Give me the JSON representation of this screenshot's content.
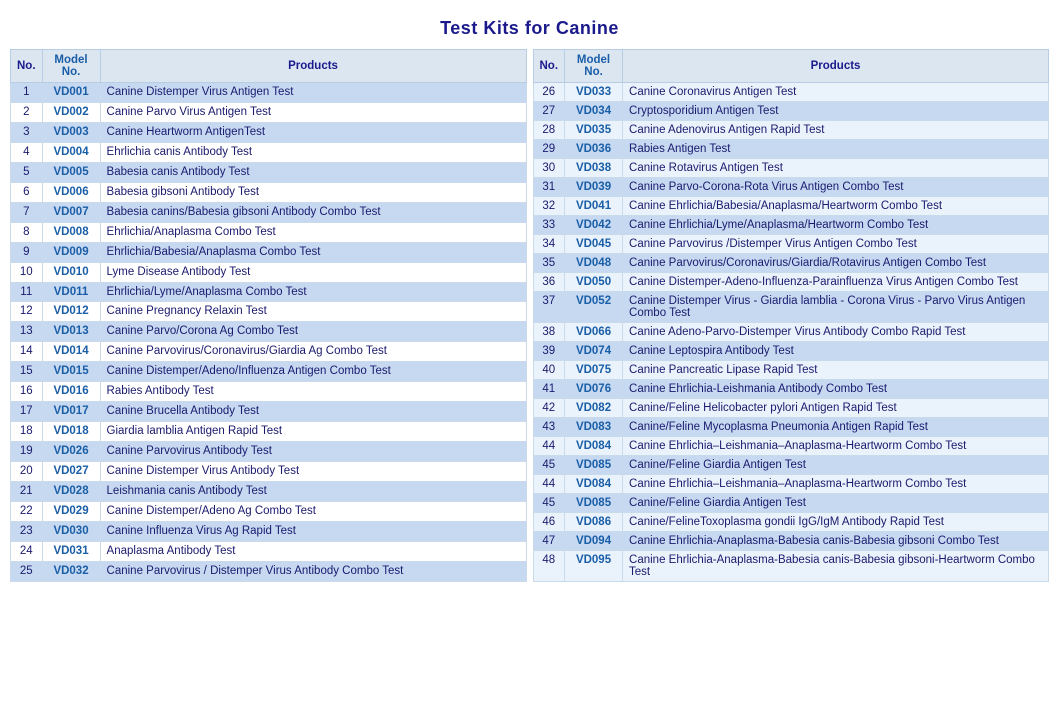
{
  "title": "Test Kits for Canine",
  "left_columns": [
    "No.",
    "Model No.",
    "Products"
  ],
  "right_columns": [
    "No.",
    "Model No.",
    "Products"
  ],
  "left_rows": [
    {
      "no": 1,
      "model": "VD001",
      "product": "Canine Distemper Virus Antigen Test",
      "highlight": true
    },
    {
      "no": 2,
      "model": "VD002",
      "product": "Canine Parvo Virus Antigen Test",
      "highlight": false
    },
    {
      "no": 3,
      "model": "VD003",
      "product": "Canine Heartworm AntigenTest",
      "highlight": true
    },
    {
      "no": 4,
      "model": "VD004",
      "product": "Ehrlichia canis Antibody Test",
      "highlight": false
    },
    {
      "no": 5,
      "model": "VD005",
      "product": "Babesia canis Antibody Test",
      "highlight": true
    },
    {
      "no": 6,
      "model": "VD006",
      "product": "Babesia gibsoni Antibody Test",
      "highlight": false
    },
    {
      "no": 7,
      "model": "VD007",
      "product": "Babesia canins/Babesia gibsoni Antibody Combo Test",
      "highlight": true
    },
    {
      "no": 8,
      "model": "VD008",
      "product": "Ehrlichia/Anaplasma Combo Test",
      "highlight": false
    },
    {
      "no": 9,
      "model": "VD009",
      "product": "Ehrlichia/Babesia/Anaplasma Combo Test",
      "highlight": true
    },
    {
      "no": 10,
      "model": "VD010",
      "product": "Lyme Disease Antibody Test",
      "highlight": false
    },
    {
      "no": 11,
      "model": "VD011",
      "product": "Ehrlichia/Lyme/Anaplasma Combo Test",
      "highlight": true
    },
    {
      "no": 12,
      "model": "VD012",
      "product": "Canine Pregnancy Relaxin Test",
      "highlight": false
    },
    {
      "no": 13,
      "model": "VD013",
      "product": "Canine Parvo/Corona Ag Combo Test",
      "highlight": true
    },
    {
      "no": 14,
      "model": "VD014",
      "product": "Canine Parvovirus/Coronavirus/Giardia Ag Combo Test",
      "highlight": false
    },
    {
      "no": 15,
      "model": "VD015",
      "product": "Canine Distemper/Adeno/Influenza Antigen Combo Test",
      "highlight": true
    },
    {
      "no": 16,
      "model": "VD016",
      "product": "Rabies Antibody Test",
      "highlight": false
    },
    {
      "no": 17,
      "model": "VD017",
      "product": "Canine Brucella Antibody Test",
      "highlight": true
    },
    {
      "no": 18,
      "model": "VD018",
      "product": "Giardia lamblia Antigen Rapid Test",
      "highlight": false
    },
    {
      "no": 19,
      "model": "VD026",
      "product": "Canine Parvovirus Antibody Test",
      "highlight": true
    },
    {
      "no": 20,
      "model": "VD027",
      "product": "Canine Distemper Virus Antibody Test",
      "highlight": false
    },
    {
      "no": 21,
      "model": "VD028",
      "product": "Leishmania canis Antibody Test",
      "highlight": true
    },
    {
      "no": 22,
      "model": "VD029",
      "product": "Canine Distemper/Adeno Ag Combo Test",
      "highlight": false
    },
    {
      "no": 23,
      "model": "VD030",
      "product": "Canine Influenza Virus Ag Rapid Test",
      "highlight": true
    },
    {
      "no": 24,
      "model": "VD031",
      "product": "Anaplasma Antibody Test",
      "highlight": false
    },
    {
      "no": 25,
      "model": "VD032",
      "product": "Canine Parvovirus / Distemper Virus Antibody Combo Test",
      "highlight": true
    }
  ],
  "right_rows": [
    {
      "no": 26,
      "model": "VD033",
      "product": "Canine Coronavirus Antigen Test",
      "highlight": false
    },
    {
      "no": 27,
      "model": "VD034",
      "product": "Cryptosporidium Antigen Test",
      "highlight": true
    },
    {
      "no": 28,
      "model": "VD035",
      "product": "Canine Adenovirus Antigen Rapid Test",
      "highlight": false
    },
    {
      "no": 29,
      "model": "VD036",
      "product": "Rabies Antigen Test",
      "highlight": true
    },
    {
      "no": 30,
      "model": "VD038",
      "product": "Canine Rotavirus Antigen Test",
      "highlight": false
    },
    {
      "no": 31,
      "model": "VD039",
      "product": "Canine Parvo-Corona-Rota Virus Antigen Combo Test",
      "highlight": true
    },
    {
      "no": 32,
      "model": "VD041",
      "product": "Canine Ehrlichia/Babesia/Anaplasma/Heartworm Combo Test",
      "highlight": false
    },
    {
      "no": 33,
      "model": "VD042",
      "product": "Canine Ehrlichia/Lyme/Anaplasma/Heartworm Combo Test",
      "highlight": true
    },
    {
      "no": 34,
      "model": "VD045",
      "product": "Canine Parvovirus /Distemper Virus Antigen Combo Test",
      "highlight": false
    },
    {
      "no": 35,
      "model": "VD048",
      "product": "Canine Parvovirus/Coronavirus/Giardia/Rotavirus Antigen Combo Test",
      "highlight": true
    },
    {
      "no": 36,
      "model": "VD050",
      "product": "Canine Distemper-Adeno-Influenza-Parainfluenza Virus Antigen Combo Test",
      "highlight": false
    },
    {
      "no": 37,
      "model": "VD052",
      "product": "Canine Distemper Virus - Giardia lamblia - Corona Virus - Parvo Virus Antigen Combo Test",
      "highlight": true
    },
    {
      "no": 38,
      "model": "VD066",
      "product": "Canine Adeno-Parvo-Distemper Virus Antibody Combo Rapid Test",
      "highlight": false
    },
    {
      "no": 39,
      "model": "VD074",
      "product": "Canine Leptospira Antibody Test",
      "highlight": true
    },
    {
      "no": 40,
      "model": "VD075",
      "product": "Canine Pancreatic Lipase Rapid Test",
      "highlight": false
    },
    {
      "no": 41,
      "model": "VD076",
      "product": "Canine Ehrlichia-Leishmania Antibody Combo Test",
      "highlight": true
    },
    {
      "no": 42,
      "model": "VD082",
      "product": "Canine/Feline Helicobacter pylori Antigen Rapid Test",
      "highlight": false
    },
    {
      "no": 43,
      "model": "VD083",
      "product": "Canine/Feline  Mycoplasma Pneumonia Antigen Rapid Test",
      "highlight": true
    },
    {
      "no": 44,
      "model": "VD084",
      "product": "Canine Ehrlichia–Leishmania–Anaplasma-Heartworm Combo Test",
      "highlight": false
    },
    {
      "no": 45,
      "model": "VD085",
      "product": "Canine/Feline  Giardia Antigen Test",
      "highlight": true
    },
    {
      "no": 44,
      "model": "VD084",
      "product": "Canine Ehrlichia–Leishmania–Anaplasma-Heartworm Combo Test",
      "highlight": false
    },
    {
      "no": 45,
      "model": "VD085",
      "product": "Canine/Feline  Giardia Antigen Test",
      "highlight": true
    },
    {
      "no": 46,
      "model": "VD086",
      "product": "Canine/FelineToxoplasma gondii IgG/IgM Antibody Rapid Test",
      "highlight": false
    },
    {
      "no": 47,
      "model": "VD094",
      "product": "Canine Ehrlichia-Anaplasma-Babesia canis-Babesia gibsoni Combo Test",
      "highlight": true
    },
    {
      "no": 48,
      "model": "VD095",
      "product": "Canine Ehrlichia-Anaplasma-Babesia canis-Babesia gibsoni-Heartworm Combo Test",
      "highlight": false
    }
  ]
}
